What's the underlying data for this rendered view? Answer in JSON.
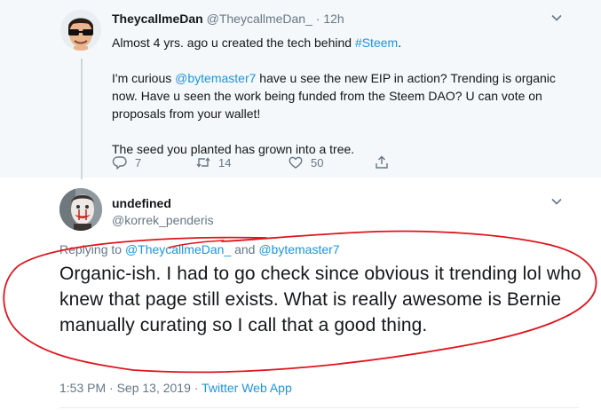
{
  "parent_tweet": {
    "display_name": "TheycallmeDan",
    "handle": "@TheycallmeDan_",
    "separator": "·",
    "time": "12h",
    "line1_prefix": "Almost 4 yrs. ago u created the tech behind ",
    "line1_hashtag": "#Steem",
    "line1_suffix": ".",
    "para2_prefix": "I'm curious ",
    "para2_mention": "@bytemaster7",
    "para2_suffix": " have u see the new EIP in action? Trending is organic now. Have u seen the work being funded from the Steem DAO? U can vote on proposals from your wallet!",
    "para3": "The seed you planted has grown into a tree.",
    "actions": {
      "reply_count": "7",
      "retweet_count": "14",
      "like_count": "50"
    }
  },
  "reply_tweet": {
    "display_name": "undefined",
    "handle": "@korrek_penderis",
    "replying_prefix": "Replying to ",
    "mention1": "@TheycallmeDan_",
    "and": " and ",
    "mention2": "@bytemaster7",
    "text": "Organic-ish. I had to go check since obvious it trending lol who knew that page still exists. What is really awesome is Bernie manually curating so I call that a good thing.",
    "timestamp": "1:53 PM · Sep 13, 2019 · ",
    "source": "Twitter Web App"
  },
  "colors": {
    "link": "#1b95e0",
    "secondary_text": "#657786",
    "parent_background": "#f5f8fa",
    "annotation_red": "#e0141e"
  },
  "icons": [
    "chevron-down-icon",
    "reply-icon",
    "retweet-icon",
    "like-icon",
    "share-icon",
    "avatar-sunglasses",
    "avatar-clown"
  ]
}
